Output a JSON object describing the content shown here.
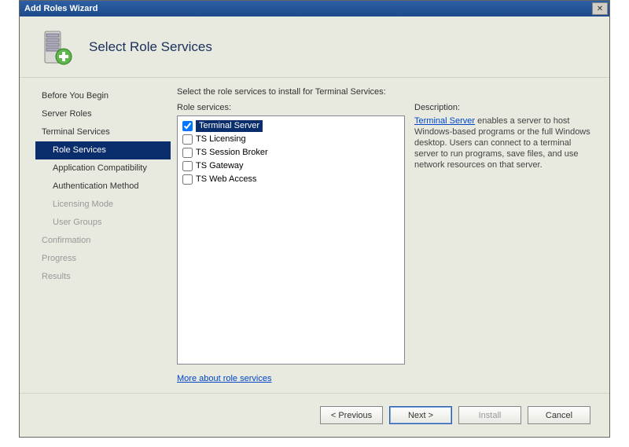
{
  "titlebar": {
    "title": "Add Roles Wizard"
  },
  "header": {
    "title": "Select Role Services"
  },
  "nav": {
    "items": [
      {
        "label": "Before You Begin",
        "sub": false,
        "selected": false,
        "disabled": false
      },
      {
        "label": "Server Roles",
        "sub": false,
        "selected": false,
        "disabled": false
      },
      {
        "label": "Terminal Services",
        "sub": false,
        "selected": false,
        "disabled": false
      },
      {
        "label": "Role Services",
        "sub": true,
        "selected": true,
        "disabled": false
      },
      {
        "label": "Application Compatibility",
        "sub": true,
        "selected": false,
        "disabled": false
      },
      {
        "label": "Authentication Method",
        "sub": true,
        "selected": false,
        "disabled": false
      },
      {
        "label": "Licensing Mode",
        "sub": true,
        "selected": false,
        "disabled": true
      },
      {
        "label": "User Groups",
        "sub": true,
        "selected": false,
        "disabled": true
      },
      {
        "label": "Confirmation",
        "sub": false,
        "selected": false,
        "disabled": true
      },
      {
        "label": "Progress",
        "sub": false,
        "selected": false,
        "disabled": true
      },
      {
        "label": "Results",
        "sub": false,
        "selected": false,
        "disabled": true
      }
    ]
  },
  "main": {
    "instruction": "Select the role services to install for Terminal Services:",
    "servicesLabel": "Role services:",
    "services": [
      {
        "label": "Terminal Server",
        "checked": true,
        "highlighted": true
      },
      {
        "label": "TS Licensing",
        "checked": false,
        "highlighted": false
      },
      {
        "label": "TS Session Broker",
        "checked": false,
        "highlighted": false
      },
      {
        "label": "TS Gateway",
        "checked": false,
        "highlighted": false
      },
      {
        "label": "TS Web Access",
        "checked": false,
        "highlighted": false
      }
    ],
    "descriptionLabel": "Description:",
    "description": {
      "linkText": "Terminal Server",
      "rest": " enables a server to host Windows-based programs or the full Windows desktop. Users can connect to a terminal server to run programs, save files, and use network resources on that server."
    },
    "moreLink": "More about role services"
  },
  "footer": {
    "previous": "< Previous",
    "next": "Next >",
    "install": "Install",
    "cancel": "Cancel"
  }
}
